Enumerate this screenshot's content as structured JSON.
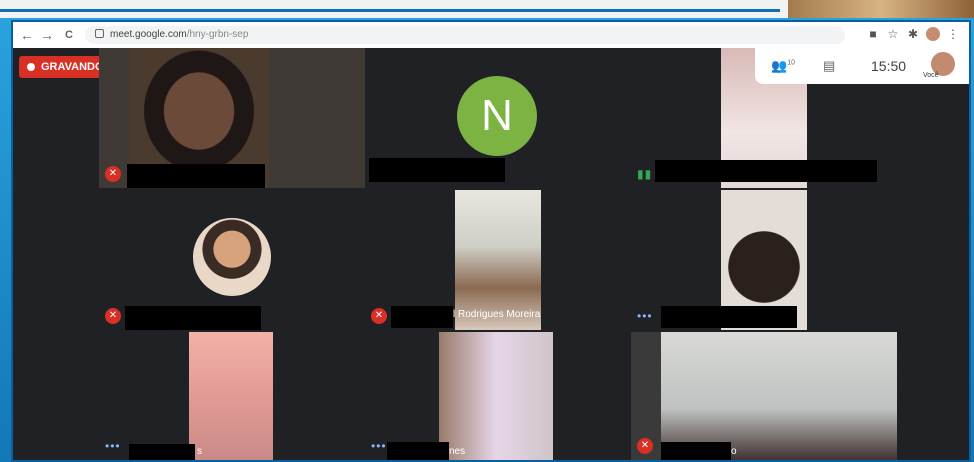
{
  "browser": {
    "url_host": "meet.google.com",
    "url_path": "/hny-grbn-sep",
    "nav": {
      "back": "←",
      "forward": "→",
      "reload": "C"
    }
  },
  "meet": {
    "recording_label": "GRAVANDO",
    "clock": "15:50",
    "participants_count": "10",
    "self_label": "Você",
    "avatar_letter": "N",
    "tiles": [
      {
        "name": "",
        "state": "muted"
      },
      {
        "name": "",
        "state": "avatar"
      },
      {
        "name": "",
        "state": "speaking"
      },
      {
        "name": "",
        "state": "muted"
      },
      {
        "name": "l Rodrigues Moreira",
        "state": "muted"
      },
      {
        "name": "",
        "state": "dots"
      },
      {
        "name": "s",
        "state": "dots"
      },
      {
        "name": "nes",
        "state": "dots"
      },
      {
        "name": "o",
        "state": "muted"
      }
    ]
  },
  "colors": {
    "mute": "#d93025",
    "avatar": "#7cb342",
    "frame": "#1a8fcf"
  }
}
